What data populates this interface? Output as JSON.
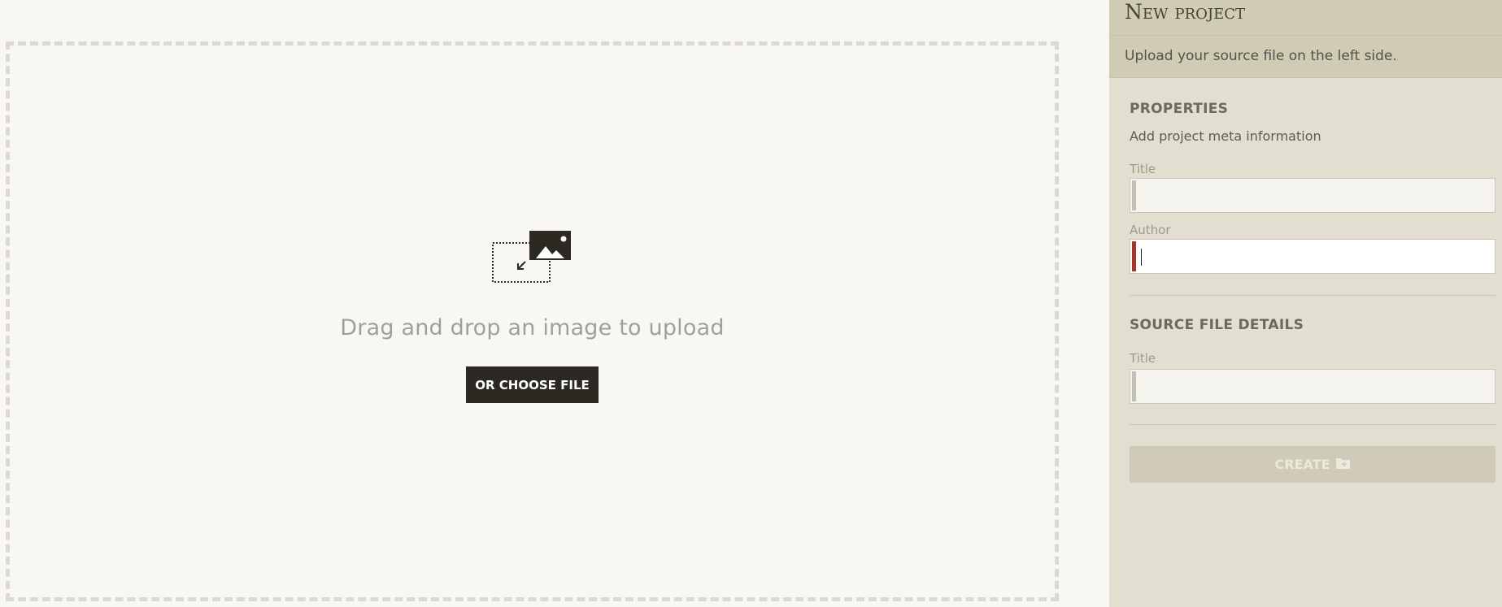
{
  "upload": {
    "drop_text": "Drag and drop an image to upload",
    "choose_button_label": "OR CHOOSE FILE",
    "icon": "image-upload-icon"
  },
  "panel": {
    "title": "New project",
    "subtitle": "Upload your source file on the left side.",
    "properties": {
      "heading": "PROPERTIES",
      "description": "Add project meta information",
      "title_label": "Title",
      "title_value": "",
      "author_label": "Author",
      "author_value": ""
    },
    "source": {
      "heading": "SOURCE FILE DETAILS",
      "title_label": "Title",
      "title_value": ""
    },
    "create_button_label": "CREATE",
    "create_icon": "folder-plus-icon"
  },
  "colors": {
    "background": "#f8f7f3",
    "panel": "#e2dfd0",
    "panel_header": "#d0cbb3",
    "button_dark": "#2b2922",
    "error_bar": "#a3362b",
    "create_disabled": "#d0cbb8"
  }
}
